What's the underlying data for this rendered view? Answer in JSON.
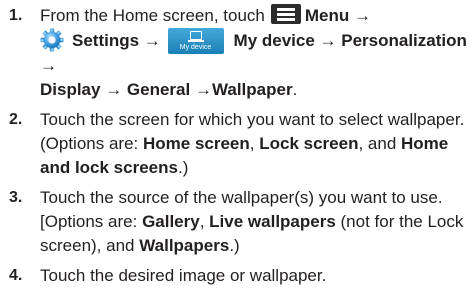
{
  "steps": [
    {
      "number": "1.",
      "t1": "From the Home screen, touch",
      "menu_label": "Menu →",
      "settings_label": "Settings →",
      "my_device_caption": "My device",
      "path_rest": "My device → Personalization →",
      "path_line2": "Display → General →Wallpaper",
      "end": "."
    },
    {
      "number": "2.",
      "t1": "Touch the screen for which you want to select wallpaper. (Options are: ",
      "opt1": "Home screen",
      "sep1": ", ",
      "opt2": "Lock screen",
      "sep2": ", and ",
      "opt3": "Home and lock screens",
      "end": ".)"
    },
    {
      "number": "3.",
      "t1": "Touch the source of the wallpaper(s) you want to use. [Options are: ",
      "opt1": "Gallery",
      "sep1": ", ",
      "opt2": "Live wallpapers",
      "t2": " (not for the Lock screen), and ",
      "opt3": "Wallpapers",
      "end": ".)"
    },
    {
      "number": "4.",
      "t1": "Touch the desired image or wallpaper."
    }
  ],
  "icons": {
    "menu": "menu-icon",
    "settings": "gear-icon",
    "my_device": "my-device-icon"
  },
  "colors": {
    "text": "#231f20",
    "settings_icon": "#2e8fd0",
    "my_device_icon": "#1f8fc7"
  }
}
